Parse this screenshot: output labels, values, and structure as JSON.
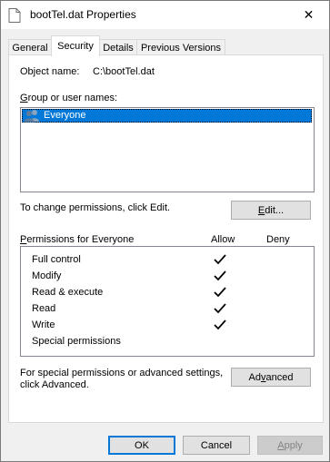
{
  "window": {
    "title": "bootTel.dat Properties",
    "close_glyph": "✕"
  },
  "tabs": [
    {
      "label": "General",
      "active": false
    },
    {
      "label": "Security",
      "active": true
    },
    {
      "label": "Details",
      "active": false
    },
    {
      "label": "Previous Versions",
      "active": false
    }
  ],
  "security": {
    "object_name_label": "Object name:",
    "object_name_value": "C:\\bootTel.dat",
    "group_label_first": "G",
    "group_label_rest": "roup or user names:",
    "groups": [
      {
        "name": "Everyone",
        "icon": "users-icon",
        "selected": true
      }
    ],
    "change_text": "To change permissions, click Edit.",
    "edit_button": {
      "underline": "E",
      "rest": "dit..."
    },
    "permissions_label_first": "P",
    "permissions_label_rest": "ermissions for Everyone",
    "allow_header": "Allow",
    "deny_header": "Deny",
    "permissions": [
      {
        "name": "Full control",
        "allow": true,
        "deny": false
      },
      {
        "name": "Modify",
        "allow": true,
        "deny": false
      },
      {
        "name": "Read & execute",
        "allow": true,
        "deny": false
      },
      {
        "name": "Read",
        "allow": true,
        "deny": false
      },
      {
        "name": "Write",
        "allow": true,
        "deny": false
      },
      {
        "name": "Special permissions",
        "allow": false,
        "deny": false
      }
    ],
    "advanced_text_line1": "For special permissions or advanced settings,",
    "advanced_text_line2": "click Advanced.",
    "advanced_button": {
      "before": "Ad",
      "underline": "v",
      "after": "anced"
    }
  },
  "footer": {
    "ok": "OK",
    "cancel": "Cancel",
    "apply_underline": "A",
    "apply_rest": "pply"
  },
  "colors": {
    "selection": "#0078d7",
    "accent_border": "#0078d7"
  }
}
